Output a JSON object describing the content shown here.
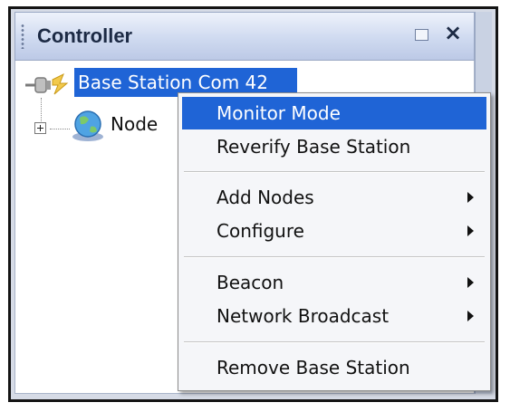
{
  "panel": {
    "title": "Controller",
    "restore_icon": "restore-icon",
    "close_glyph": "×"
  },
  "tree": {
    "base_station_label": "Base Station Com 42",
    "nodes_label": "Node"
  },
  "context_menu": {
    "items": [
      {
        "label": "Monitor Mode",
        "highlighted": true,
        "submenu": false
      },
      {
        "label": "Reverify Base Station",
        "submenu": false
      },
      {
        "label": "Add Nodes",
        "submenu": true
      },
      {
        "label": "Configure",
        "submenu": true
      },
      {
        "label": "Beacon",
        "submenu": true
      },
      {
        "label": "Network Broadcast",
        "submenu": true
      },
      {
        "label": "Remove Base Station",
        "submenu": false
      }
    ]
  },
  "colors": {
    "selection": "#1f64d6",
    "titlebar": "#cfdaf0"
  }
}
